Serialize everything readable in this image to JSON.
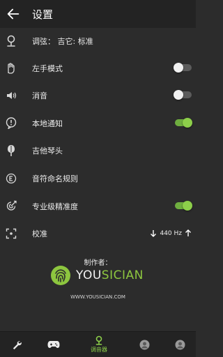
{
  "header": {
    "title": "设置",
    "back_icon": "arrow-left-icon"
  },
  "settings": [
    {
      "label": "调弦： 吉它: 标准",
      "icon": "tuning-fork-icon"
    },
    {
      "label": "左手模式",
      "icon": "left-hand-icon",
      "toggle": false
    },
    {
      "label": "消音",
      "icon": "speaker-icon",
      "toggle": false
    },
    {
      "label": "本地通知",
      "icon": "notification-icon",
      "toggle": true
    },
    {
      "label": "吉他琴头",
      "icon": "guitar-headstock-icon"
    },
    {
      "label": "音符命名规则",
      "icon": "note-naming-icon"
    },
    {
      "label": "专业级精准度",
      "icon": "precision-icon",
      "toggle": true
    },
    {
      "label": "校准",
      "icon": "calibrate-icon",
      "value": "440 Hz"
    }
  ],
  "credits": {
    "maker_label": "制作者：",
    "logo_text_prefix": "YOU",
    "logo_text_suffix": "SICIAN",
    "website": "WWW.YOUSICIAN.COM"
  },
  "bottom_nav": [
    {
      "label": "",
      "icon": "wrench-icon"
    },
    {
      "label": "",
      "icon": "gamepad-icon"
    },
    {
      "label": "调音器",
      "icon": "tuner-icon",
      "active": true
    },
    {
      "label": "",
      "icon": "avatar-icon"
    },
    {
      "label": "",
      "icon": "avatar-icon"
    }
  ],
  "colors": {
    "accent": "#8dcf4a",
    "background": "#2c2c2c",
    "header": "#232323"
  }
}
